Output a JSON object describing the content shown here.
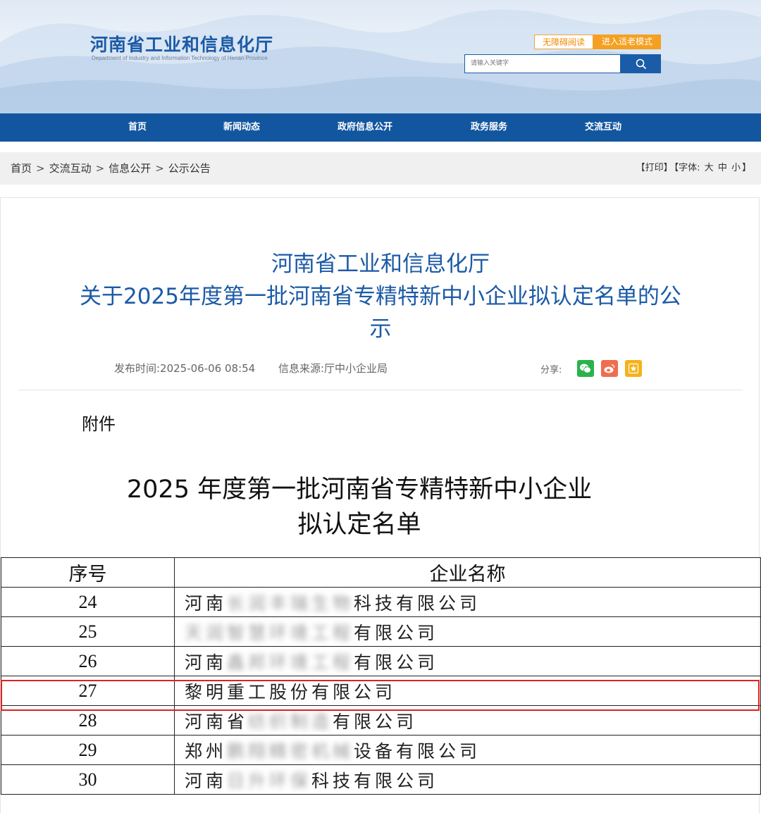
{
  "header": {
    "title": "河南省工业和信息化厅",
    "subtitle": "Department of Industry and Information Technology of Henan Province",
    "accessibility_label": "无障碍阅读",
    "elder_mode_label": "进入适老模式",
    "search_placeholder": "请输入关键字",
    "search_icon": "search-icon"
  },
  "nav": [
    "首页",
    "新闻动态",
    "政府信息公开",
    "政务服务",
    "交流互动"
  ],
  "breadcrumb": {
    "items": [
      "首页",
      "交流互动",
      "信息公开",
      "公示公告"
    ],
    "separator": ">"
  },
  "tools": {
    "print": "【打印】",
    "font_prefix": "【字体:",
    "large": "大",
    "medium": "中",
    "small": "小",
    "font_suffix": "】"
  },
  "article": {
    "title_lines": [
      "河南省工业和信息化厅",
      "关于2025年度第一批河南省专精特新中小企业拟认定名单的公",
      "示"
    ],
    "publish_time": "发布时间:2025-06-06 08:54",
    "source": "信息来源:厅中小企业局",
    "share_label": "分享:",
    "share_icons": [
      "wechat-icon",
      "weibo-icon",
      "favorite-icon"
    ],
    "attachment_label": "附件",
    "list_title_lines": [
      "2025 年度第一批河南省专精特新中小企业",
      "拟认定名单"
    ]
  },
  "table": {
    "headers": [
      "序号",
      "企业名称"
    ],
    "rows": [
      {
        "num": "24",
        "pre": "河南",
        "hidden": "长润丰瑞生物",
        "post": "科技有限公司"
      },
      {
        "num": "25",
        "pre": "",
        "hidden": "天润智慧环境工程",
        "post": "有限公司"
      },
      {
        "num": "26",
        "pre": "河南",
        "hidden": "鑫邦环境工程",
        "post": "有限公司"
      },
      {
        "num": "27",
        "pre": "黎明重工股份有限公司",
        "hidden": "",
        "post": ""
      },
      {
        "num": "28",
        "pre": "河南省",
        "hidden": "纺织制造",
        "post": "有限公司"
      },
      {
        "num": "29",
        "pre": "郑州",
        "hidden": "鹏翔精密机械",
        "post": "设备有限公司"
      },
      {
        "num": "30",
        "pre": "河南",
        "hidden": "日升环保",
        "post": "科技有限公司"
      }
    ],
    "highlighted_row": "27"
  },
  "colors": {
    "brand_blue": "#1b5aa6",
    "nav_blue": "#12569f",
    "accent_orange": "#f5a020",
    "highlight_red": "#e02020",
    "wechat_green": "#2bb24c",
    "weibo_orange": "#f06d4f",
    "fav_yellow": "#f5b21a"
  }
}
